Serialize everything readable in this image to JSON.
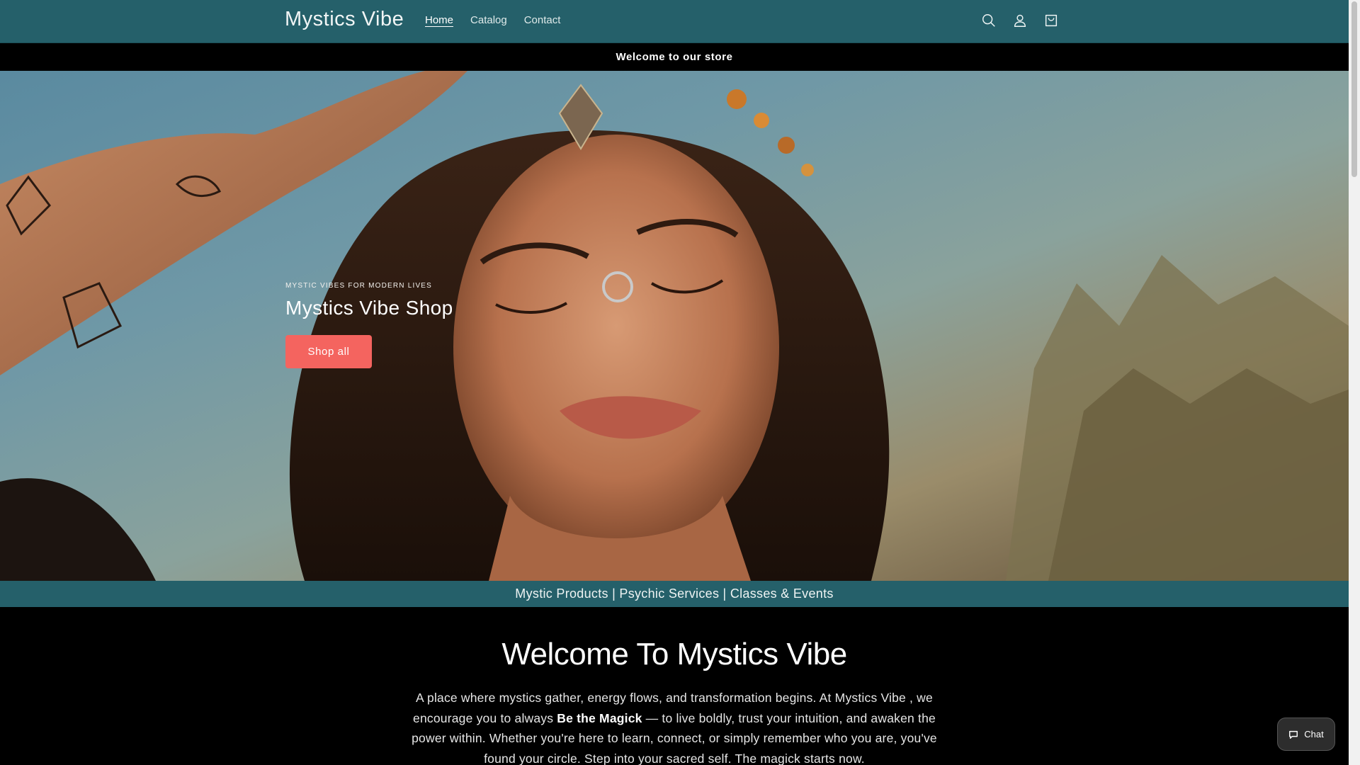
{
  "header": {
    "logo": "Mystics Vibe",
    "nav": [
      {
        "label": "Home",
        "active": true
      },
      {
        "label": "Catalog",
        "active": false
      },
      {
        "label": "Contact",
        "active": false
      }
    ],
    "icons": [
      "search-icon",
      "account-icon",
      "cart-icon"
    ],
    "background_color": "#25606a"
  },
  "announcement": {
    "text": "Welcome to our store"
  },
  "hero": {
    "subheading": "MYSTIC VIBES FOR MODERN LIVES",
    "title": "Mystics Vibe Shop",
    "button_label": "Shop all",
    "button_color": "#f4645f"
  },
  "strip": {
    "text": "Mystic Products | Psychic Services | Classes & Events"
  },
  "welcome": {
    "heading": "Welcome To Mystics Vibe",
    "text_before": "A place where mystics gather, energy flows, and transformation begins. At Mystics Vibe , we encourage you to always ",
    "text_bold": "Be the Magick",
    "text_after": " — to live boldly, trust your intuition, and awaken the power within. Whether you're here to learn, connect, or simply remember who you are, you've found your circle. Step into your sacred self. The magick starts now."
  },
  "chat": {
    "label": "Chat",
    "icon": "chat-bubble-icon"
  }
}
